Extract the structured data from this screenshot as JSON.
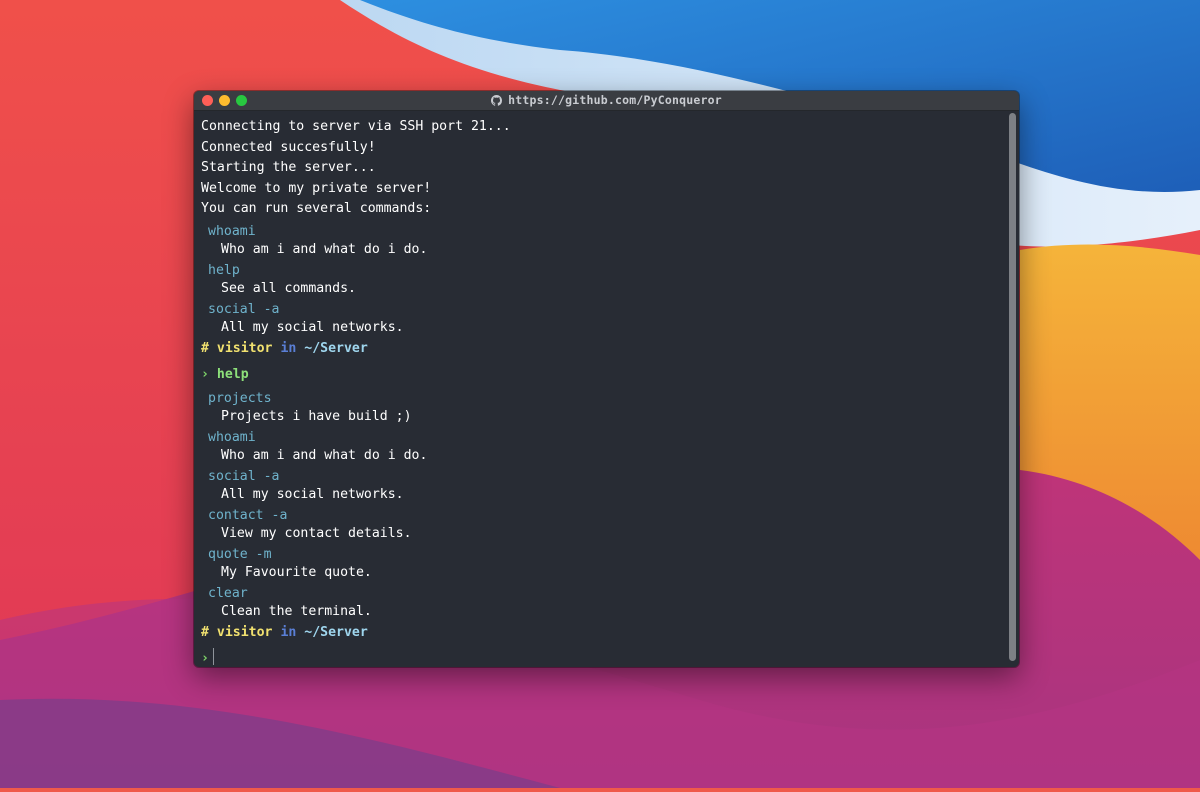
{
  "window": {
    "title": "https://github.com/PyConqueror"
  },
  "terminal": {
    "intro": [
      "Connecting to server via SSH port 21...",
      "Connected succesfully!",
      "Starting the server...",
      "Welcome to my private server!",
      "You can run several commands:"
    ],
    "intro_commands": [
      {
        "cmd": "whoami",
        "desc": "Who am i and what do i do."
      },
      {
        "cmd": "help",
        "desc": "See all commands."
      },
      {
        "cmd": "social -a",
        "desc": "All my social networks."
      }
    ],
    "prompt": {
      "hash": "#",
      "user": "visitor",
      "in": "in",
      "path": "~/Server"
    },
    "arrow": "›",
    "entered_command": "help",
    "help_commands": [
      {
        "cmd": "projects",
        "desc": "Projects i have build ;)"
      },
      {
        "cmd": "whoami",
        "desc": "Who am i and what do i do."
      },
      {
        "cmd": "social -a",
        "desc": "All my social networks."
      },
      {
        "cmd": "contact -a",
        "desc": "View my contact details."
      },
      {
        "cmd": "quote -m",
        "desc": "My Favourite quote."
      },
      {
        "cmd": "clear",
        "desc": "Clean the terminal."
      }
    ]
  },
  "colors": {
    "terminal_bg": "#282c34",
    "command": "#6fb3cc",
    "prompt_user": "#f1e16f",
    "prompt_in": "#5a7fd6",
    "prompt_path": "#9fd6ee",
    "arrow": "#7fd66a"
  },
  "icons": {
    "title_icon": "github-icon"
  }
}
